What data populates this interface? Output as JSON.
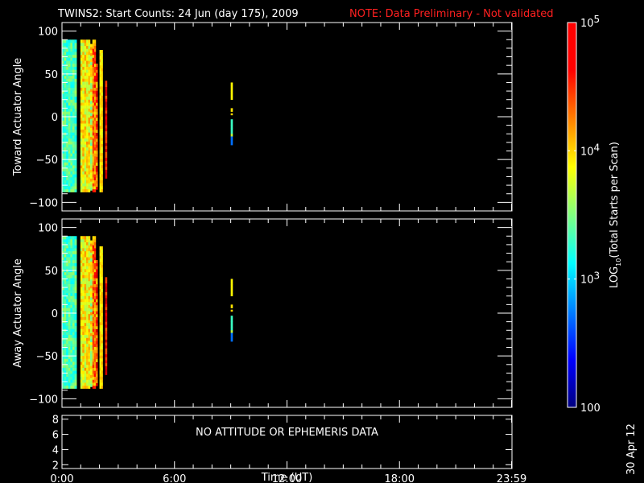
{
  "chart_data": {
    "type": "heatmap",
    "title": "TWINS2: Start Counts: 24 Jun (day 175), 2009",
    "note": "NOTE: Data Preliminary - Not validated",
    "note_color": "#ff2020",
    "xlabel": "Time (UT)",
    "xlim": [
      0,
      24
    ],
    "xticks": [
      {
        "v": 0,
        "label": "0:00"
      },
      {
        "v": 6,
        "label": "6:00"
      },
      {
        "v": 12,
        "label": "12:00"
      },
      {
        "v": 18,
        "label": "18:00"
      },
      {
        "v": 23.98,
        "label": "23:59"
      }
    ],
    "panels": [
      {
        "ylabel": "Toward Actuator Angle",
        "ylim": [
          -110,
          110
        ],
        "yticks": [
          100,
          50,
          0,
          -50,
          -100
        ]
      },
      {
        "ylabel": "Away Actuator Angle",
        "ylim": [
          -110,
          110
        ],
        "yticks": [
          100,
          50,
          0,
          -50,
          -100
        ]
      }
    ],
    "orbit_panel": {
      "yticks": [
        8,
        6,
        4,
        2
      ],
      "ylim": [
        1.5,
        8.5
      ],
      "message": "NO ATTITUDE OR EPHEMERIS DATA"
    },
    "colorbar": {
      "label": "LOG10(Total Starts per Scan)",
      "label_main": "LOG",
      "label_sub": "10",
      "label_rest": "(Total Starts per Scan)",
      "range_log10": [
        2,
        5
      ],
      "ticks": [
        {
          "v": 5,
          "base": "10",
          "exp": "5"
        },
        {
          "v": 4,
          "base": "10",
          "exp": "4"
        },
        {
          "v": 3,
          "base": "10",
          "exp": "3"
        },
        {
          "v": 2,
          "label": "100"
        }
      ]
    },
    "columns": [
      {
        "t0": 0.0,
        "t1": 0.78,
        "a0": -88,
        "a1": 90,
        "log10": 3.35,
        "var": 0.25
      },
      {
        "t0": 0.98,
        "t1": 1.5,
        "a0": -88,
        "a1": 90,
        "log10": 3.9,
        "var": 0.3
      },
      {
        "t0": 1.5,
        "t1": 1.62,
        "a0": -86,
        "a1": 85,
        "log10": 3.8,
        "var": 0.4
      },
      {
        "t0": 1.62,
        "t1": 1.8,
        "a0": -88,
        "a1": 90,
        "log10": 4.3,
        "var": 0.35
      },
      {
        "t0": 1.8,
        "t1": 1.9,
        "a0": -85,
        "a1": 62,
        "log10": 4.4,
        "var": 0.4
      },
      {
        "t0": 2.0,
        "t1": 2.17,
        "a0": -88,
        "a1": 78,
        "log10": 3.95,
        "var": 0.15
      },
      {
        "t0": 2.3,
        "t1": 2.4,
        "a0": -72,
        "a1": 42,
        "log10": 4.6,
        "var": 0.25
      },
      {
        "t0": 9.0,
        "t1": 9.1,
        "a0": 20,
        "a1": 40,
        "log10": 3.9,
        "var": 0
      },
      {
        "t0": 9.0,
        "t1": 9.1,
        "a0": 6,
        "a1": 10,
        "log10": 3.95,
        "var": 0
      },
      {
        "t0": 9.0,
        "t1": 9.1,
        "a0": 2,
        "a1": 4,
        "log10": 4.0,
        "var": 0
      },
      {
        "t0": 9.0,
        "t1": 9.1,
        "a0": -20,
        "a1": -3,
        "log10": 3.3,
        "var": 0
      },
      {
        "t0": 9.0,
        "t1": 9.1,
        "a0": -23,
        "a1": -20,
        "log10": 3.7,
        "var": 0
      },
      {
        "t0": 9.0,
        "t1": 9.1,
        "a0": -33,
        "a1": -23,
        "log10": 2.7,
        "var": 0
      }
    ],
    "date_stamp": "30 Apr 12"
  }
}
